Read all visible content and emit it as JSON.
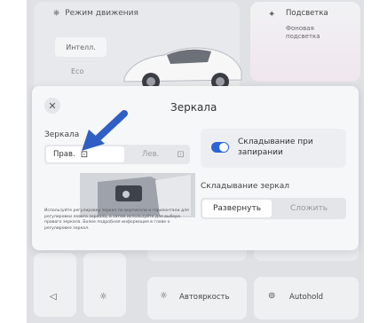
{
  "background": {
    "drive_mode_label": "Режим движения",
    "drive_mode_value": "Интелл.",
    "drive_eco": "Eco",
    "lighting_title": "Подсветка",
    "lighting_sub": "Фоновая подсветка",
    "autohold_label": "Autohold",
    "autobrightness_label": "Автояркость"
  },
  "modal": {
    "title": "Зеркала",
    "close_icon": "close-icon",
    "mirrors_label": "Зеркала",
    "side_options": [
      "Прав.",
      "Лев."
    ],
    "selected_side": "Прав.",
    "description": "Используйте регулировку зеркал по вертикали и горизонтали для регулировки левого зеркала, а затем используйте для выбора правого зеркала. Более подробная информация в главе о регулировке зеркал.",
    "toggle_label": "Складывание при запирании",
    "toggle_on": true,
    "fold_label": "Складывание зеркал",
    "fold_options": [
      "Развернуть",
      "Сложить"
    ],
    "fold_selected": "Развернуть"
  },
  "colors": {
    "accent": "#2b63d9",
    "arrow": "#2f5fc4"
  }
}
